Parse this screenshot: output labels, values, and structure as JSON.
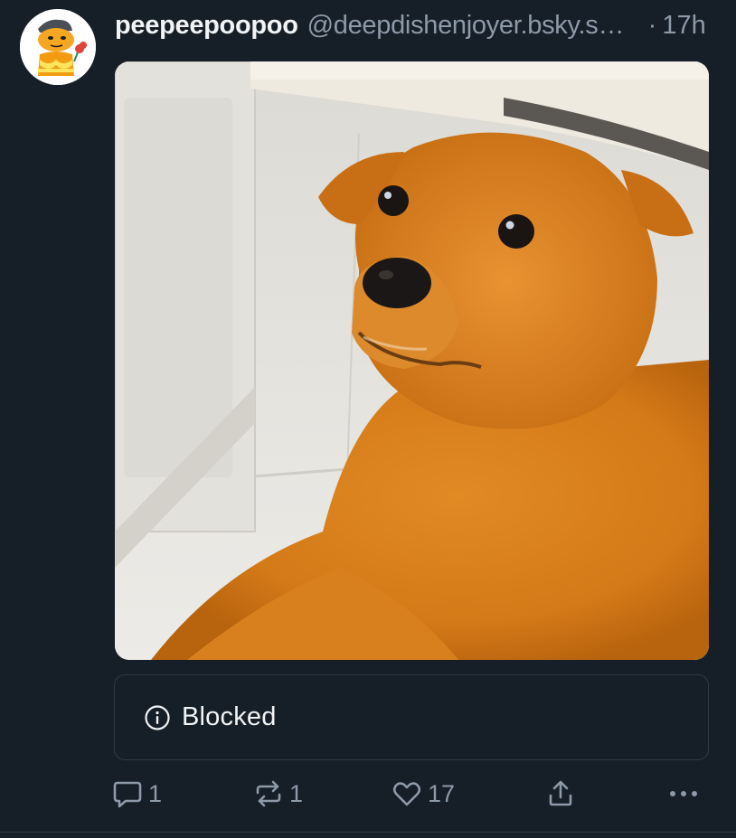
{
  "post": {
    "author": {
      "display_name": "peepeepoopoo",
      "handle": "@deepdishenjoyer.bsky.social"
    },
    "dot": "·",
    "time": "17h",
    "image": {
      "description_icon": "dog-photo"
    },
    "label_card": {
      "icon": "info-icon",
      "text": "Blocked"
    },
    "actions": {
      "reply_count": "1",
      "repost_count": "1",
      "like_count": "17"
    }
  },
  "colors": {
    "background": "#161e27",
    "muted_text": "#8d9aa9",
    "border": "#2e3a47"
  }
}
